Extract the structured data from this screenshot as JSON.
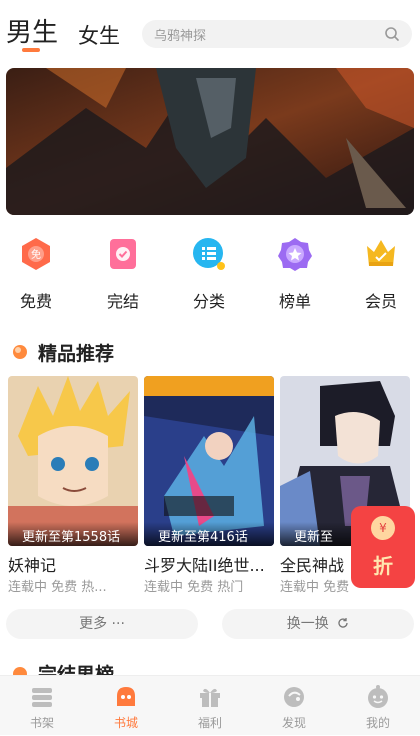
{
  "header": {
    "tab_male": "男生",
    "tab_female": "女生",
    "search_placeholder": "乌鸦神探"
  },
  "categories": [
    {
      "label": "免费",
      "icon": "free-icon",
      "color": "#ff6a4a"
    },
    {
      "label": "完结",
      "icon": "finished-icon",
      "color": "#ff6f9a"
    },
    {
      "label": "分类",
      "icon": "category-icon",
      "color": "#27b6f0"
    },
    {
      "label": "榜单",
      "icon": "ranking-icon",
      "color": "#9c6bf2"
    },
    {
      "label": "会员",
      "icon": "vip-crown-icon",
      "color": "#f5b820"
    }
  ],
  "section_featured": {
    "title": "精品推荐",
    "books": [
      {
        "caption": "更新至第1558话",
        "title": "妖神记",
        "tags": "连载中 免费 热..."
      },
      {
        "caption": "更新至第416话",
        "title": "斗罗大陆II绝世...",
        "tags": "连载中 免费 热门"
      },
      {
        "caption": "更新至",
        "title": "全民神战",
        "tags": "连载中 免费"
      }
    ],
    "more_label": "更多 ···",
    "refresh_label": "换一换"
  },
  "red_packet": {
    "label": "折",
    "coin": "¥"
  },
  "section_finished": {
    "title": "完结男榜"
  },
  "bottom_nav": [
    {
      "label": "书架",
      "icon": "bookshelf-icon",
      "active": false
    },
    {
      "label": "书城",
      "icon": "bookstore-icon",
      "active": true
    },
    {
      "label": "福利",
      "icon": "gift-icon",
      "active": false
    },
    {
      "label": "发现",
      "icon": "discover-icon",
      "active": false
    },
    {
      "label": "我的",
      "icon": "profile-icon",
      "active": false
    }
  ],
  "colors": {
    "accent": "#ff7a3d",
    "red_packet": "#f44343"
  }
}
